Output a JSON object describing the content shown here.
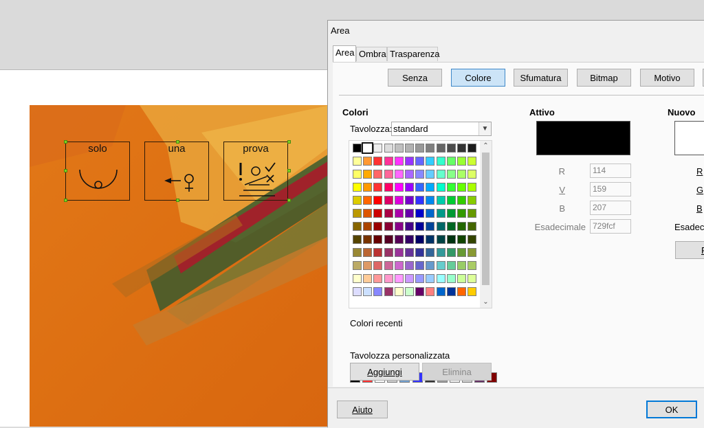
{
  "symbols": [
    {
      "label": "solo"
    },
    {
      "label": "una"
    },
    {
      "label": "prova"
    }
  ],
  "dialog": {
    "title": "Area",
    "tabs": [
      "Area",
      "Ombra",
      "Trasparenza"
    ],
    "fill_types": [
      "Senza",
      "Colore",
      "Sfumatura",
      "Bitmap",
      "Motivo"
    ],
    "selected_fill_type": "Colore",
    "colors_heading": "Colori",
    "palette_label": "Tavolozza:",
    "palette_value": "standard",
    "recent_label": "Colori recenti",
    "custom_palette_label": "Tavolozza personalizzata",
    "add_label": "Aggiungi",
    "delete_label": "Elimina",
    "active_heading": "Attivo",
    "new_heading": "Nuovo",
    "active_color": "#000000",
    "new_color": "#ffffff",
    "r_label": "R",
    "g_label": "V",
    "b_label": "B",
    "hex_label": "Esadecimale",
    "r_value": "114",
    "g_value": "159",
    "b_value": "207",
    "hex_value": "729fcf",
    "new_r_label": "R",
    "new_g_label": "G",
    "new_b_label": "B",
    "new_hex_label": "Esadeci",
    "new_pick_label": "P",
    "help_label": "Aiuto",
    "ok_label": "OK"
  },
  "palette_rows": [
    [
      "#000000",
      "#ffffff",
      "#eeeeee",
      "#dddddd",
      "#c0c0c0",
      "#b2b2b2",
      "#999999",
      "#808080",
      "#666666",
      "#4c4c4c",
      "#333333",
      "#1c1c1c"
    ],
    [
      "#ffff99",
      "#ff9933",
      "#ff3333",
      "#ff3399",
      "#ff33ff",
      "#9933ff",
      "#6666ff",
      "#33ccff",
      "#33ffcc",
      "#66ff66",
      "#99ff33",
      "#ccff33"
    ],
    [
      "#ffff66",
      "#ffaa00",
      "#ff6666",
      "#ff6699",
      "#ff66ff",
      "#aa66ff",
      "#8888ff",
      "#66ccff",
      "#66ffcc",
      "#88ff88",
      "#aaff66",
      "#ddff66"
    ],
    [
      "#ffff00",
      "#ff9900",
      "#ff3333",
      "#ff0066",
      "#ff00ff",
      "#9900ff",
      "#3366ff",
      "#00aaff",
      "#00ffcc",
      "#33ff33",
      "#66ff00",
      "#aaff00"
    ],
    [
      "#ddcc00",
      "#ff6600",
      "#ff0000",
      "#dd0066",
      "#dd00dd",
      "#7700cc",
      "#3333ff",
      "#0088ee",
      "#00ccaa",
      "#00cc33",
      "#33cc00",
      "#88cc00"
    ],
    [
      "#bb9900",
      "#dd5500",
      "#cc0000",
      "#aa0044",
      "#aa00aa",
      "#6600aa",
      "#0000cc",
      "#0066cc",
      "#009988",
      "#009933",
      "#339900",
      "#669900"
    ],
    [
      "#886600",
      "#aa4400",
      "#990000",
      "#880033",
      "#880088",
      "#440088",
      "#000099",
      "#004499",
      "#006666",
      "#006622",
      "#226600",
      "#446600"
    ],
    [
      "#554400",
      "#773300",
      "#660000",
      "#550022",
      "#550055",
      "#330066",
      "#000066",
      "#003366",
      "#004444",
      "#003311",
      "#114400",
      "#334400"
    ],
    [
      "#998833",
      "#bb6633",
      "#bb3333",
      "#993366",
      "#993399",
      "#663399",
      "#333399",
      "#336699",
      "#339999",
      "#339966",
      "#669933",
      "#889933"
    ],
    [
      "#bbaa66",
      "#dd9966",
      "#dd6666",
      "#cc6699",
      "#cc66cc",
      "#9966cc",
      "#6666cc",
      "#6699cc",
      "#66cccc",
      "#66cc99",
      "#99cc66",
      "#aacc66"
    ],
    [
      "#ffffcc",
      "#ffcc99",
      "#ff9999",
      "#ff99cc",
      "#ff99ff",
      "#cc99ff",
      "#9999ff",
      "#99ccff",
      "#99ffff",
      "#99ffcc",
      "#ccff99",
      "#ddff99"
    ],
    [
      "#ddddff",
      "#cce0ff",
      "#8888ff",
      "#993366",
      "#ffffcc",
      "#ccffcc",
      "#660066",
      "#ff8080",
      "#0066cc",
      "#003399",
      "#ff6600",
      "#ffcc00"
    ]
  ],
  "recent_colors": [
    "#000000",
    "#ff3333",
    "#ffffff",
    "#cccccc",
    "#729fcf",
    "#3333ff",
    "#333333",
    "#999999",
    "#eeeeee",
    "#cccccc",
    "#663366",
    "#800000"
  ]
}
